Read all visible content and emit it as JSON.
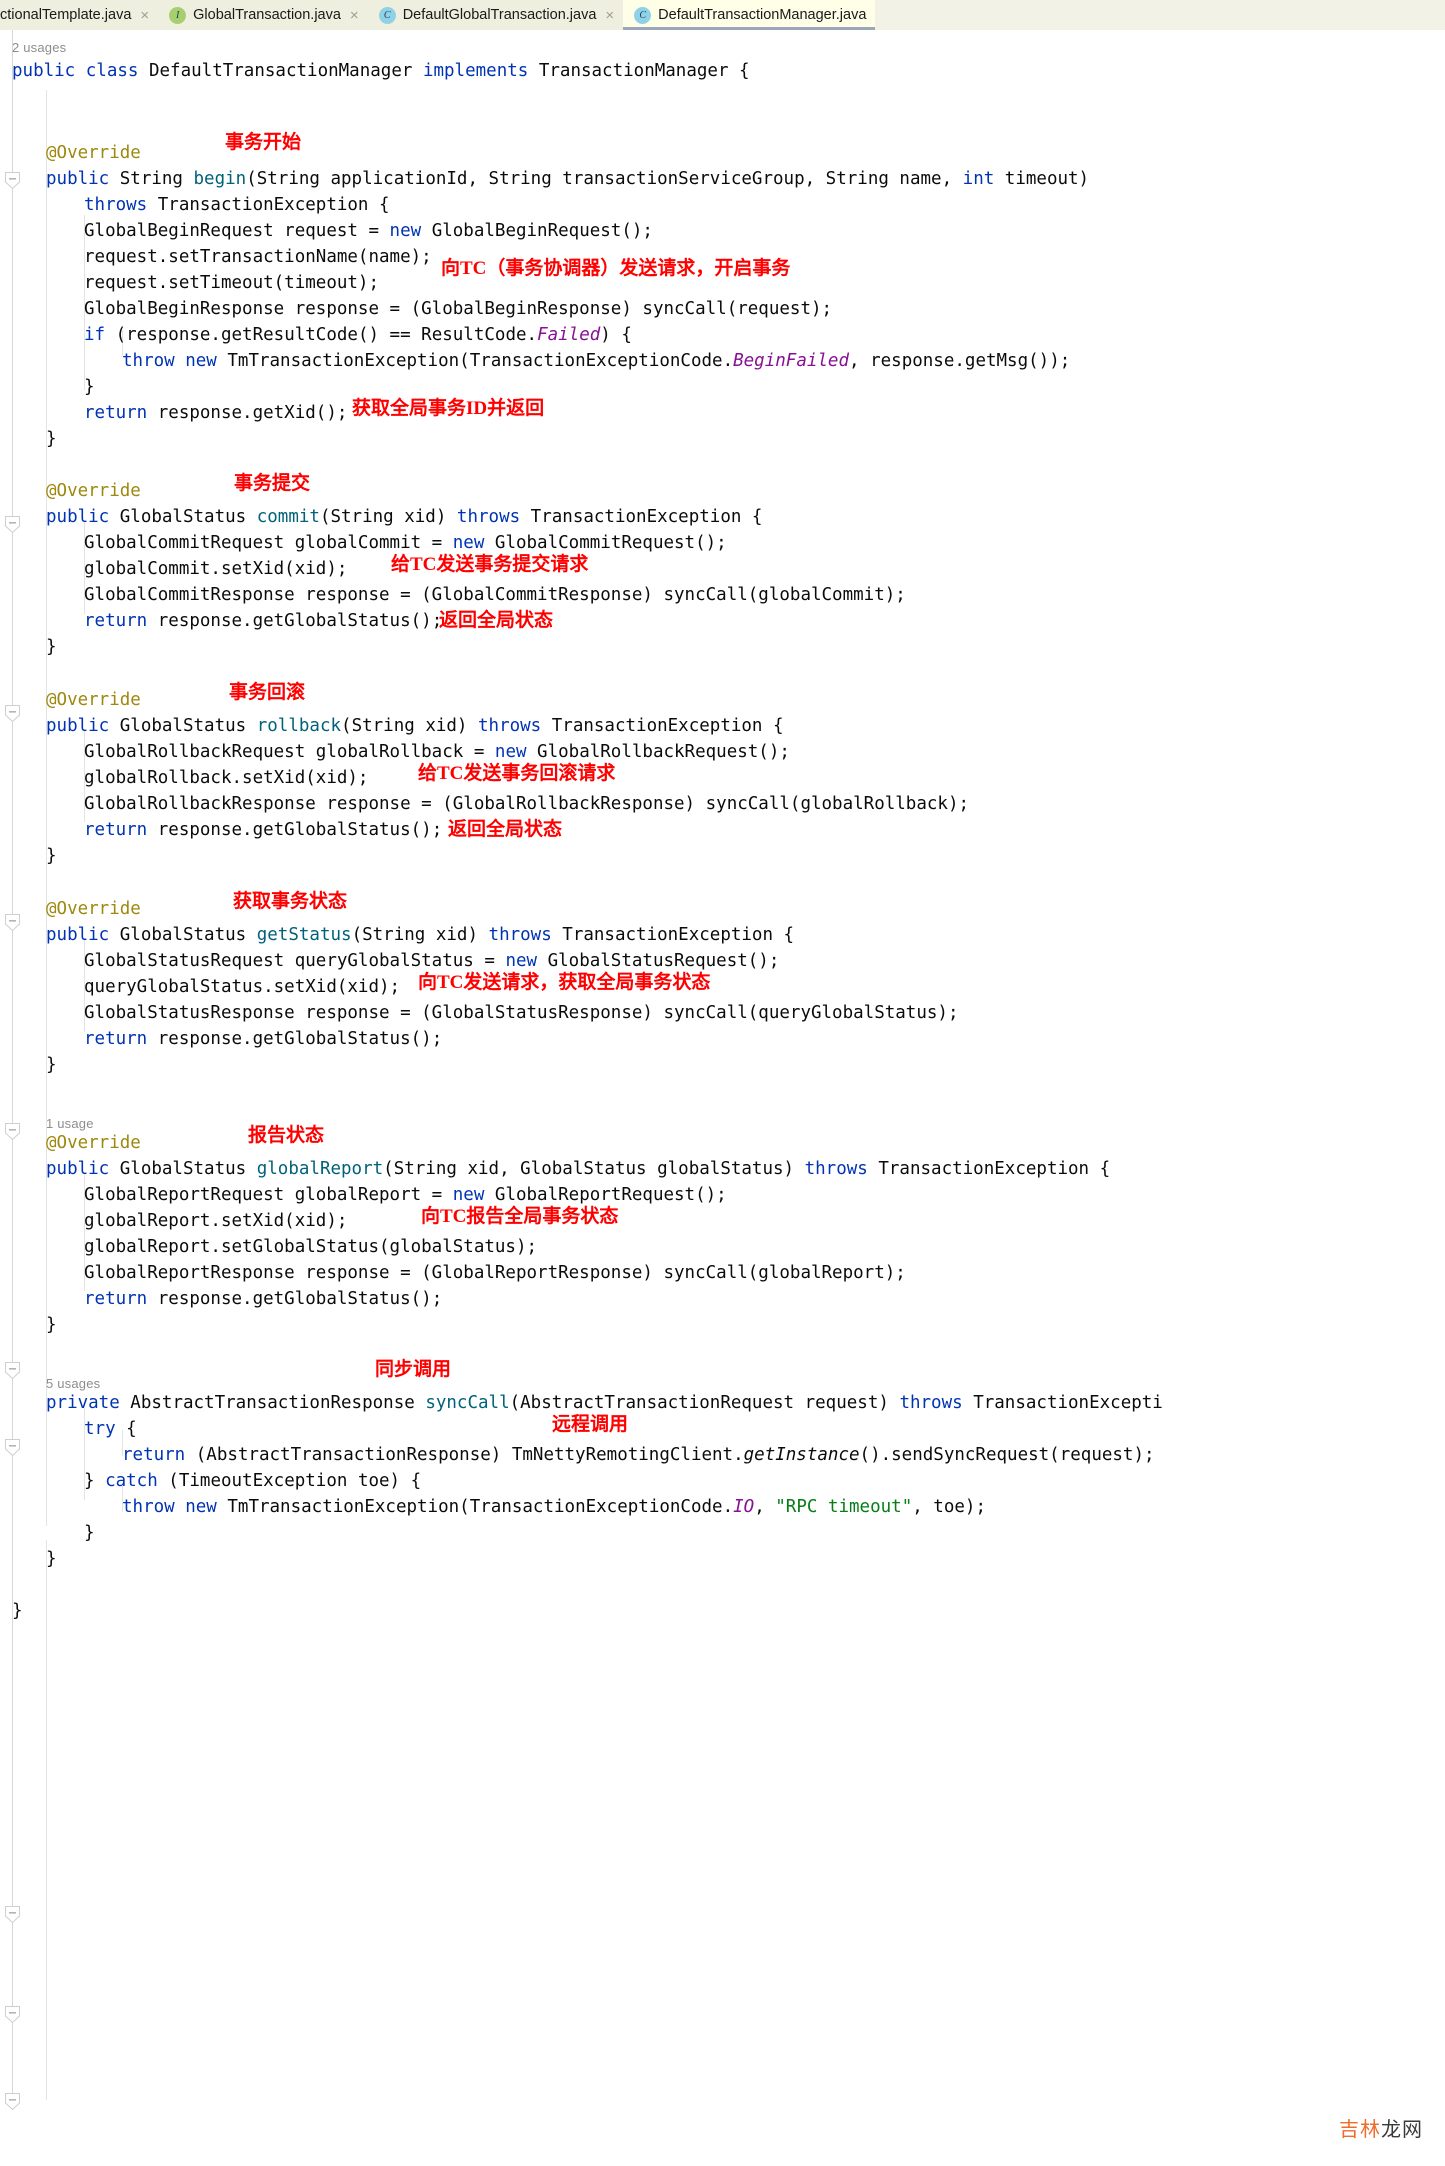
{
  "tabs": [
    {
      "label": "ctionalTemplate.java",
      "icon": "",
      "icon_letter": "",
      "clipped": true,
      "active": false,
      "close": "×"
    },
    {
      "label": "GlobalTransaction.java",
      "icon": "interface-icon",
      "icon_letter": "I",
      "clipped": false,
      "active": false,
      "close": "×"
    },
    {
      "label": "DefaultGlobalTransaction.java",
      "icon": "class-icon",
      "icon_letter": "C",
      "clipped": false,
      "active": false,
      "close": "×"
    },
    {
      "label": "DefaultTransactionManager.java",
      "icon": "class-icon",
      "icon_letter": "C",
      "clipped": false,
      "active": true,
      "close": ""
    }
  ],
  "colors": {
    "keyword": "#0033b3",
    "annotation": "#9e880d",
    "method": "#00627a",
    "static_field": "#871094",
    "string": "#067d17",
    "comment_red": "#ff0000",
    "tab_active_bg": "#ffffe8",
    "tab_bg": "#efefdf"
  },
  "usage_hints": [
    {
      "text": "2 usages"
    },
    {
      "text": "1 usage"
    },
    {
      "text": "5 usages"
    }
  ],
  "code_lines": [
    "public class DefaultTransactionManager implements TransactionManager {",
    "@Override",
    "public String begin(String applicationId, String transactionServiceGroup, String name, int timeout)",
    "throws TransactionException {",
    "GlobalBeginRequest request = new GlobalBeginRequest();",
    "request.setTransactionName(name);",
    "request.setTimeout(timeout);",
    "GlobalBeginResponse response = (GlobalBeginResponse) syncCall(request);",
    "if (response.getResultCode() == ResultCode.Failed) {",
    "throw new TmTransactionException(TransactionExceptionCode.BeginFailed, response.getMsg());",
    "}",
    "return response.getXid();",
    "}",
    "@Override",
    "public GlobalStatus commit(String xid) throws TransactionException {",
    "GlobalCommitRequest globalCommit = new GlobalCommitRequest();",
    "globalCommit.setXid(xid);",
    "GlobalCommitResponse response = (GlobalCommitResponse) syncCall(globalCommit);",
    "return response.getGlobalStatus();",
    "}",
    "@Override",
    "public GlobalStatus rollback(String xid) throws TransactionException {",
    "GlobalRollbackRequest globalRollback = new GlobalRollbackRequest();",
    "globalRollback.setXid(xid);",
    "GlobalRollbackResponse response = (GlobalRollbackResponse) syncCall(globalRollback);",
    "return response.getGlobalStatus();",
    "}",
    "@Override",
    "public GlobalStatus getStatus(String xid) throws TransactionException {",
    "GlobalStatusRequest queryGlobalStatus = new GlobalStatusRequest();",
    "queryGlobalStatus.setXid(xid);",
    "GlobalStatusResponse response = (GlobalStatusResponse) syncCall(queryGlobalStatus);",
    "return response.getGlobalStatus();",
    "}",
    "@Override",
    "public GlobalStatus globalReport(String xid, GlobalStatus globalStatus) throws TransactionException {",
    "GlobalReportRequest globalReport = new GlobalReportRequest();",
    "globalReport.setXid(xid);",
    "globalReport.setGlobalStatus(globalStatus);",
    "GlobalReportResponse response = (GlobalReportResponse) syncCall(globalReport);",
    "return response.getGlobalStatus();",
    "}",
    "private AbstractTransactionResponse syncCall(AbstractTransactionRequest request) throws TransactionExcepti",
    "try {",
    "return (AbstractTransactionResponse) TmNettyRemotingClient.getInstance().sendSyncRequest(request);",
    "} catch (TimeoutException toe) {",
    "throw new TmTransactionException(TransactionExceptionCode.IO, \"RPC timeout\", toe);",
    "}",
    "}",
    "}"
  ],
  "annotations_cn": [
    {
      "text": "事务开始",
      "meaning": "transaction-begin"
    },
    {
      "text": "向TC（事务协调器）发送请求，开启事务",
      "meaning": "send-request-to-tc-start-transaction"
    },
    {
      "text": "获取全局事务ID并返回",
      "meaning": "get-global-xid-and-return"
    },
    {
      "text": "事务提交",
      "meaning": "transaction-commit"
    },
    {
      "text": "给TC发送事务提交请求",
      "meaning": "send-commit-request-to-tc"
    },
    {
      "text": "返回全局状态",
      "meaning": "return-global-status"
    },
    {
      "text": "事务回滚",
      "meaning": "transaction-rollback"
    },
    {
      "text": "给TC发送事务回滚请求",
      "meaning": "send-rollback-request-to-tc"
    },
    {
      "text": "返回全局状态",
      "meaning": "return-global-status"
    },
    {
      "text": "获取事务状态",
      "meaning": "get-transaction-status"
    },
    {
      "text": "向TC发送请求，获取全局事务状态",
      "meaning": "send-request-to-tc-get-status"
    },
    {
      "text": "报告状态",
      "meaning": "report-status"
    },
    {
      "text": "向TC报告全局事务状态",
      "meaning": "report-global-status-to-tc"
    },
    {
      "text": "同步调用",
      "meaning": "synchronous-call"
    },
    {
      "text": "远程调用",
      "meaning": "remote-call"
    }
  ],
  "watermark": {
    "part1": "吉林",
    "part2": "龙网"
  }
}
